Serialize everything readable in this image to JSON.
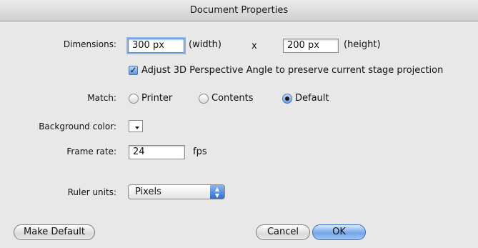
{
  "window": {
    "title": "Document Properties"
  },
  "dimensions": {
    "label": "Dimensions:",
    "width_value": "300 px",
    "width_caption": "(width)",
    "times": "x",
    "height_value": "200 px",
    "height_caption": "(height)"
  },
  "adjust3d": {
    "checked": true,
    "label": "Adjust 3D Perspective Angle to preserve current stage projection"
  },
  "match": {
    "label": "Match:",
    "options": [
      "Printer",
      "Contents",
      "Default"
    ],
    "selected": "Default"
  },
  "background": {
    "label": "Background color:",
    "color": "#ffffff"
  },
  "frame_rate": {
    "label": "Frame rate:",
    "value": "24",
    "unit": "fps"
  },
  "ruler_units": {
    "label": "Ruler units:",
    "selected": "Pixels"
  },
  "buttons": {
    "make_default": "Make Default",
    "cancel": "Cancel",
    "ok": "OK"
  }
}
